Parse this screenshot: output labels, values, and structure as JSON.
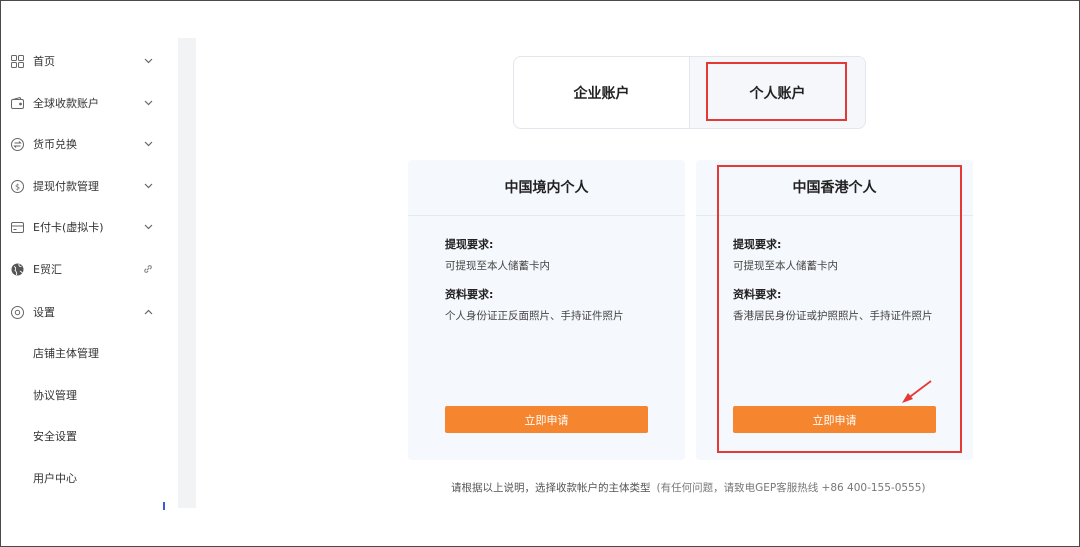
{
  "sidebar": {
    "items": [
      {
        "label": "首页",
        "icon": "grid-icon",
        "chevron": "down"
      },
      {
        "label": "全球收款账户",
        "icon": "wallet-icon",
        "chevron": "down"
      },
      {
        "label": "货币兑换",
        "icon": "exchange-icon",
        "chevron": "down"
      },
      {
        "label": "提现付款管理",
        "icon": "dollar-icon",
        "chevron": "down"
      },
      {
        "label": "E付卡(虚拟卡)",
        "icon": "card-icon",
        "chevron": "down"
      },
      {
        "label": "E贸汇",
        "icon": "globe-icon",
        "chevron": "link"
      },
      {
        "label": "设置",
        "icon": "settings-icon",
        "chevron": "up"
      }
    ],
    "sub_items": [
      "店铺主体管理",
      "协议管理",
      "安全设置",
      "用户中心"
    ]
  },
  "tabs": {
    "enterprise": "企业账户",
    "personal": "个人账户"
  },
  "cards": [
    {
      "title": "中国境内个人",
      "withdraw_title": "提现要求:",
      "withdraw_text": "可提现至本人储蓄卡内",
      "docs_title": "资料要求:",
      "docs_text": "个人身份证正反面照片、手持证件照片",
      "button": "立即申请"
    },
    {
      "title": "中国香港个人",
      "withdraw_title": "提现要求:",
      "withdraw_text": "可提现至本人储蓄卡内",
      "docs_title": "资料要求:",
      "docs_text": "香港居民身份证或护照照片、手持证件照片",
      "button": "立即申请"
    }
  ],
  "footer": {
    "main": "请根据以上说明，选择收款帐户的主体类型",
    "hint": "(有任何问题，请致电GEP客服热线 +86 400-155-0555)"
  },
  "colors": {
    "accent_orange": "#f5862f",
    "highlight_red": "#e53935"
  }
}
